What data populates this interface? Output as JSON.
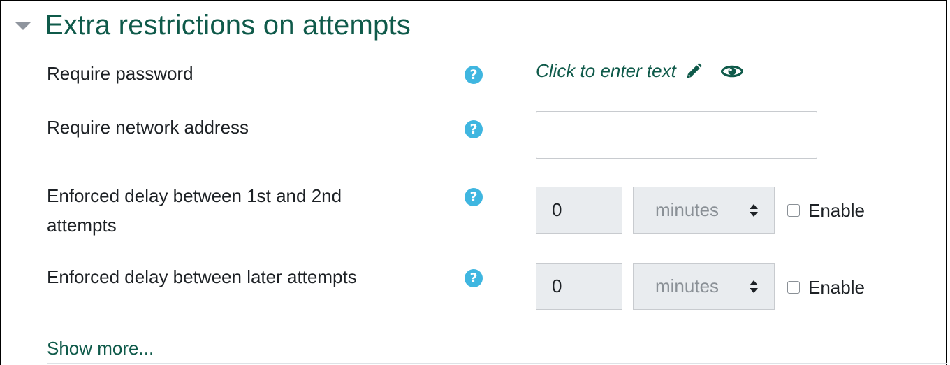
{
  "section": {
    "title": "Extra restrictions on attempts"
  },
  "rows": [
    {
      "label": "Require password",
      "help": "?",
      "control": {
        "text": "Click to enter text"
      }
    },
    {
      "label": "Require network address",
      "help": "?",
      "control": {
        "value": "",
        "placeholder": ""
      }
    },
    {
      "label_line1": "Enforced delay between 1st and 2nd",
      "label_line2": "attempts",
      "help": "?",
      "control": {
        "value": "0",
        "unit": "minutes",
        "enable_label": "Enable",
        "enabled": false
      }
    },
    {
      "label": "Enforced delay between later attempts",
      "help": "?",
      "control": {
        "value": "0",
        "unit": "minutes",
        "enable_label": "Enable",
        "enabled": false
      }
    }
  ],
  "show_more": "Show more...",
  "icons": {
    "collapse": "caret-down-icon",
    "help": "question-circle-icon",
    "edit": "pencil-icon",
    "reveal": "eye-icon",
    "select": "sort-arrows-icon"
  },
  "colors": {
    "accent": "#0f5a4a",
    "help": "#3fb6e0",
    "disabled_bg": "#e9ecef"
  }
}
